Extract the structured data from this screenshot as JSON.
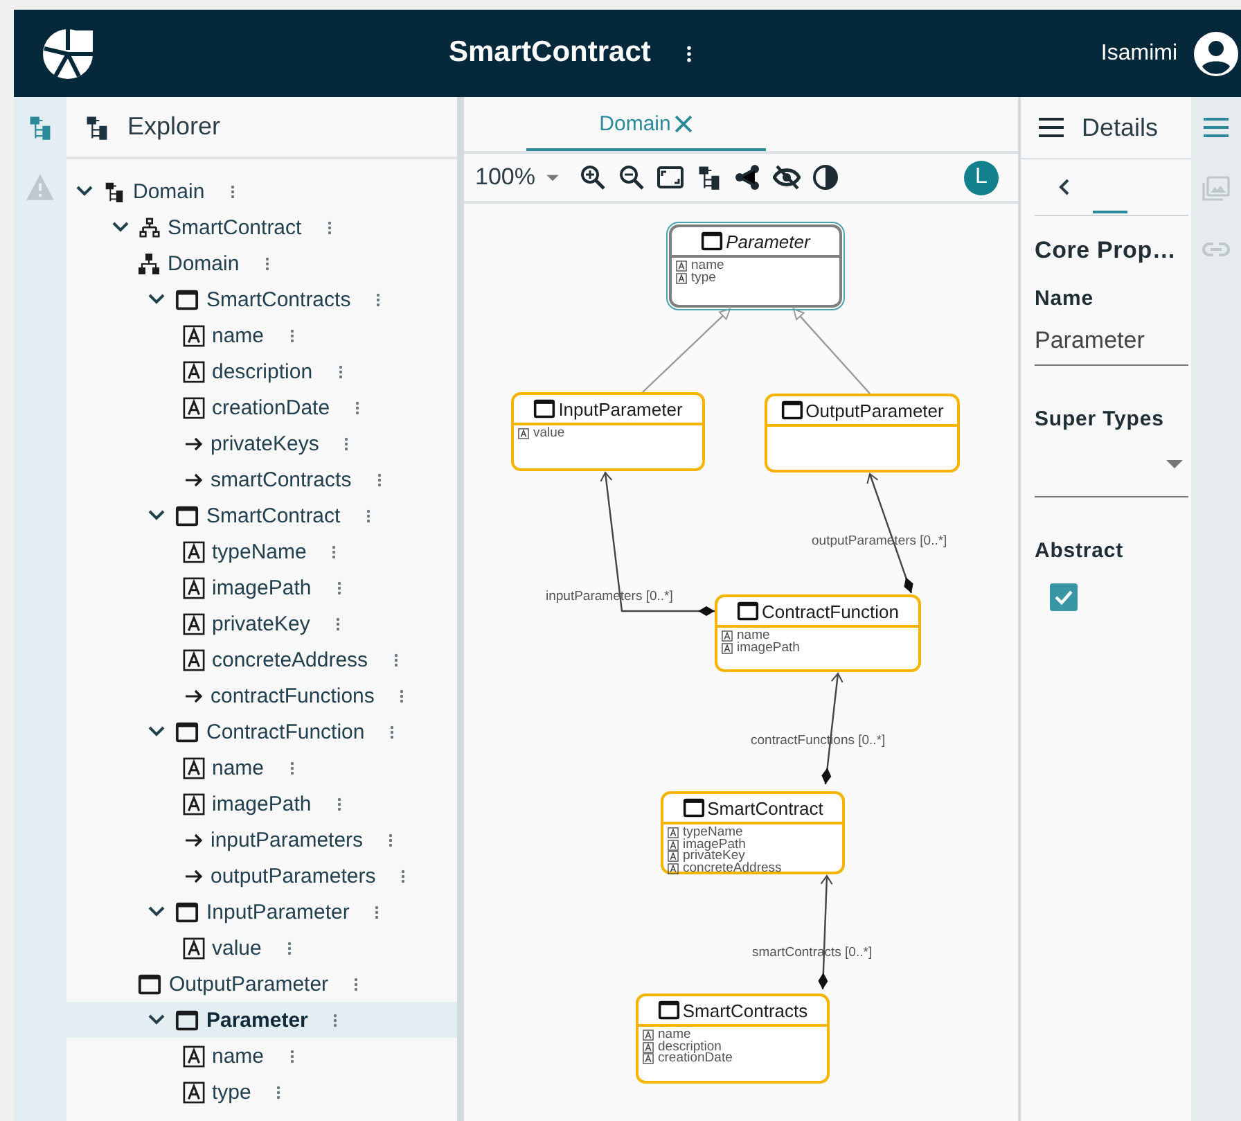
{
  "header": {
    "title": "SmartContract",
    "user": "Isamimi"
  },
  "left_rail": [
    {
      "kind": "explorer",
      "selected": true
    },
    {
      "kind": "problems",
      "selected": false
    }
  ],
  "explorer": {
    "title": "Explorer",
    "tree": [
      {
        "label": "Domain",
        "kind": "root",
        "expanded": true,
        "selected": false,
        "children": [
          {
            "label": "SmartContract",
            "kind": "diagram",
            "expanded": true,
            "selected": false,
            "children": [
              {
                "label": "Domain",
                "kind": "package",
                "selected": false
              },
              {
                "label": "SmartContracts",
                "kind": "class",
                "expanded": true,
                "selected": false,
                "children": [
                  {
                    "label": "name",
                    "kind": "attribute",
                    "selected": false
                  },
                  {
                    "label": "description",
                    "kind": "attribute",
                    "selected": false
                  },
                  {
                    "label": "creationDate",
                    "kind": "attribute",
                    "selected": false
                  },
                  {
                    "label": "privateKeys",
                    "kind": "reference",
                    "selected": false
                  },
                  {
                    "label": "smartContracts",
                    "kind": "reference",
                    "selected": false
                  }
                ]
              },
              {
                "label": "SmartContract",
                "kind": "class",
                "expanded": true,
                "selected": false,
                "children": [
                  {
                    "label": "typeName",
                    "kind": "attribute",
                    "selected": false
                  },
                  {
                    "label": "imagePath",
                    "kind": "attribute",
                    "selected": false
                  },
                  {
                    "label": "privateKey",
                    "kind": "attribute",
                    "selected": false
                  },
                  {
                    "label": "concreteAddress",
                    "kind": "attribute",
                    "selected": false
                  },
                  {
                    "label": "contractFunctions",
                    "kind": "reference",
                    "selected": false
                  }
                ]
              },
              {
                "label": "ContractFunction",
                "kind": "class",
                "expanded": true,
                "selected": false,
                "children": [
                  {
                    "label": "name",
                    "kind": "attribute",
                    "selected": false
                  },
                  {
                    "label": "imagePath",
                    "kind": "attribute",
                    "selected": false
                  },
                  {
                    "label": "inputParameters",
                    "kind": "reference",
                    "selected": false
                  },
                  {
                    "label": "outputParameters",
                    "kind": "reference",
                    "selected": false
                  }
                ]
              },
              {
                "label": "InputParameter",
                "kind": "class",
                "expanded": true,
                "selected": false,
                "children": [
                  {
                    "label": "value",
                    "kind": "attribute",
                    "selected": false
                  }
                ]
              },
              {
                "label": "OutputParameter",
                "kind": "class",
                "selected": false
              },
              {
                "label": "Parameter",
                "kind": "class",
                "expanded": true,
                "selected": true,
                "children": [
                  {
                    "label": "name",
                    "kind": "attribute",
                    "selected": false
                  },
                  {
                    "label": "type",
                    "kind": "attribute",
                    "selected": false
                  }
                ]
              }
            ]
          }
        ]
      }
    ]
  },
  "editor": {
    "tabs": [
      {
        "label": "Domain",
        "selected": true
      }
    ],
    "zoom": "100%",
    "avatar": "L",
    "nodes": [
      {
        "name": "Parameter",
        "abstract": true,
        "selected": true,
        "attributes": [
          "name",
          "type"
        ]
      },
      {
        "name": "InputParameter",
        "abstract": false,
        "selected": false,
        "attributes": [
          "value"
        ]
      },
      {
        "name": "OutputParameter",
        "abstract": false,
        "selected": false
      },
      {
        "name": "ContractFunction",
        "abstract": false,
        "selected": false,
        "attributes": [
          "name",
          "imagePath"
        ]
      },
      {
        "name": "SmartContract",
        "abstract": false,
        "selected": false,
        "attributes": [
          "typeName",
          "imagePath",
          "privateKey",
          "concreteAddress"
        ]
      },
      {
        "name": "SmartContracts",
        "abstract": false,
        "selected": false,
        "attributes": [
          "name",
          "description",
          "creationDate"
        ]
      }
    ],
    "edges": [
      {
        "kind": "generalization"
      },
      {
        "kind": "generalization"
      },
      {
        "kind": "composition",
        "label": "inputParameters [0..*]"
      },
      {
        "kind": "composition",
        "label": "outputParameters [0..*]"
      },
      {
        "kind": "composition",
        "label": "contractFunctions [0..*]"
      },
      {
        "kind": "composition",
        "label": "smartContracts [0..*]"
      }
    ]
  },
  "details": {
    "title": "Details",
    "section": "Core Prop…",
    "fields": [
      {
        "kind": "text",
        "label": "Name",
        "value": "Parameter"
      },
      {
        "kind": "select",
        "label": "Super Types"
      },
      {
        "kind": "checkbox",
        "label": "Abstract",
        "checked": true
      }
    ]
  },
  "right_rail": [
    {
      "kind": "menu",
      "selected": true
    },
    {
      "kind": "image",
      "selected": false
    },
    {
      "kind": "link",
      "selected": false
    }
  ]
}
